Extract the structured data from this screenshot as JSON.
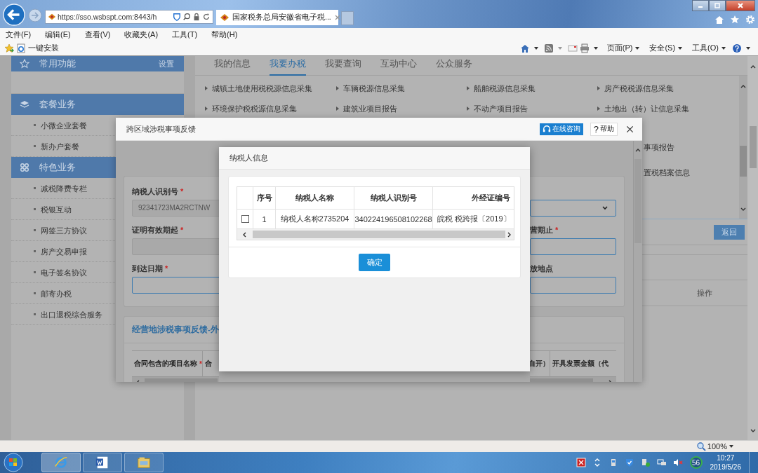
{
  "browser": {
    "address": "https://sso.wsbspt.com:8443/h",
    "tab_title": "国家税务总局安徽省电子税...",
    "menu": [
      "文件(F)",
      "编辑(E)",
      "查看(V)",
      "收藏夹(A)",
      "工具(T)",
      "帮助(H)"
    ],
    "favorites": [
      "一键安装"
    ],
    "commands": [
      "页面(P)",
      "安全(S)",
      "工具(O)"
    ]
  },
  "sidebar": {
    "sections": [
      {
        "title": "常用功能",
        "action": "设置"
      },
      {
        "title": "套餐业务",
        "items": [
          "小微企业套餐",
          "新办户套餐"
        ]
      },
      {
        "title": "特色业务",
        "items": [
          "减税降费专栏",
          "税银互动",
          "网签三方协议",
          "房产交易申报",
          "电子签名协议",
          "邮寄办税",
          "出口退税综合服务"
        ]
      }
    ]
  },
  "main": {
    "tabs": [
      {
        "label": "我的信息",
        "selected": false
      },
      {
        "label": "我要办税",
        "selected": true
      },
      {
        "label": "我要查询",
        "selected": false
      },
      {
        "label": "互动中心",
        "selected": false
      },
      {
        "label": "公众服务",
        "selected": false
      }
    ],
    "service_rows": [
      [
        "城镇土地使用税税源信息采集",
        "车辆税源信息采集",
        "船舶税源信息采集",
        "房产税税源信息采集"
      ],
      [
        "环境保护税税源信息采集",
        "建筑业项目报告",
        "不动产项目报告",
        "土地出（转）让信息采集"
      ]
    ],
    "partial_services": [
      "事项报告",
      "置税档案信息"
    ],
    "back_button": "返回",
    "table_header": "操作"
  },
  "dialog": {
    "title": "跨区域涉税事项反馈",
    "consult_button": "在线咨询",
    "help_glyph": "?",
    "help_button": "帮助",
    "left_fields": [
      {
        "label": "纳税人识别号",
        "required_mark": "*",
        "value": "92341723MA2RCTNW",
        "disabled": true
      },
      {
        "label": "证明有效期起",
        "required_mark": "*",
        "disabled": true
      },
      {
        "label": "到达日期",
        "required_mark": "*",
        "disabled": false
      }
    ],
    "right_fields": [
      {
        "kind": "select",
        "disabled": false
      },
      {
        "kind": "text",
        "label": "营期止",
        "required_mark": "*",
        "disabled": false
      },
      {
        "kind": "text",
        "label": "放地点",
        "disabled": false
      }
    ],
    "section_title": "经营地涉税事项反馈-外",
    "left_columns": [
      {
        "label": "合同包含的项目名称",
        "required_mark": "*"
      },
      {
        "label": "合"
      }
    ],
    "right_columns": [
      {
        "label": "自开）"
      },
      {
        "label": "开具发票金额（代"
      }
    ]
  },
  "picker": {
    "title": "纳税人信息",
    "columns": [
      "序号",
      "纳税人名称",
      "纳税人识别号",
      "外经证编号"
    ],
    "rows": [
      {
        "checked": false,
        "cells": [
          "1",
          "纳税人名称2735204",
          "340224196508102268",
          "皖税 税跨报〔2019〕"
        ]
      }
    ],
    "confirm_button": "确定"
  },
  "status_bar": {
    "zoom": "100%"
  },
  "taskbar": {
    "tray_badge": "56",
    "time": "10:27",
    "date": "2019/5/26"
  }
}
